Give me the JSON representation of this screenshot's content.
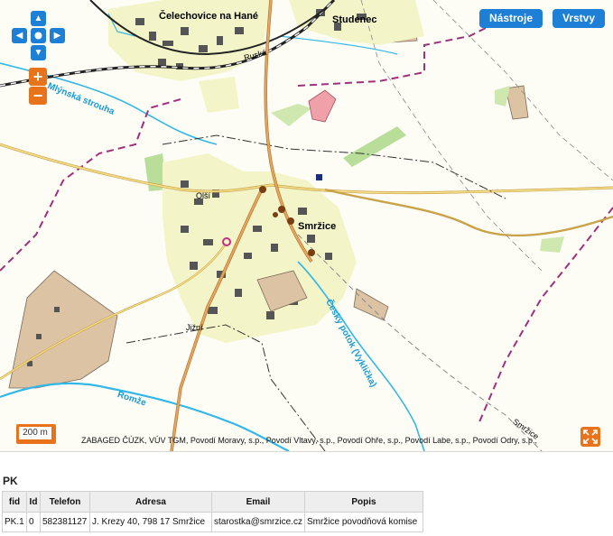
{
  "map": {
    "tools_label": "Nástroje",
    "layers_label": "Vrstvy",
    "zoom_in": "+",
    "zoom_out": "−",
    "pan_up": "▲",
    "pan_down": "▼",
    "pan_left": "◀",
    "pan_right": "▶",
    "scale": "200 m",
    "attribution": "ZABAGED ČÚZK, VÚV TGM, Povodí Moravy, s.p., Povodí Vltavy, s.p., Povodí Ohře, s.p., Povodí Labe, s.p., Povodí Odry, s.p.,",
    "labels": {
      "celechovice": "Čelechovice na Hané",
      "studenec": "Studenec",
      "ruska": "Ruská",
      "mlynska": "Mlýnská strouha",
      "olsi": "Olší",
      "smrzice": "Smržice",
      "cesky_potok": "Český potok (Vyklička)",
      "jizni": "Jižní",
      "romze": "Romže",
      "smrzice_road": "Smržice"
    },
    "icons": [
      "pan-up-icon",
      "pan-down-icon",
      "pan-left-icon",
      "pan-right-icon",
      "plus-icon",
      "minus-icon",
      "fullscreen-icon"
    ]
  },
  "panel": {
    "title": "PK",
    "columns": [
      "fid",
      "Id",
      "Telefon",
      "Adresa",
      "Email",
      "Popis"
    ],
    "rows": [
      [
        "PK.1",
        "0",
        "582381127",
        "J. Krezy 40, 798 17 Smržice",
        "starostka@smrzice.cz",
        "Smržice povodňová komise"
      ]
    ]
  }
}
